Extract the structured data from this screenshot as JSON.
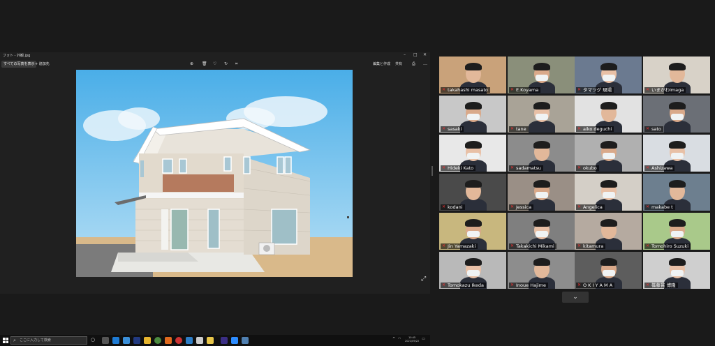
{
  "viewer": {
    "title": "フォト - 外観.jpg",
    "tab_label": "すべての写真を表示",
    "add_label": "追加先",
    "edit_label": "編集と作成",
    "share_label": "共有"
  },
  "taskbar": {
    "search_placeholder": "ここに入力して検索",
    "time": "10:45",
    "date": "2021/09/22"
  },
  "gallery": {
    "active_index": 0,
    "participants": [
      {
        "name": "takahashi masato"
      },
      {
        "name": "E.Koyama"
      },
      {
        "name": "タマツグ 現場"
      },
      {
        "name": "いまがわimaga"
      },
      {
        "name": "sasaki"
      },
      {
        "name": "tane"
      },
      {
        "name": "aiko deguchi"
      },
      {
        "name": "sato"
      },
      {
        "name": "Hideki Kato"
      },
      {
        "name": "sadamatsu"
      },
      {
        "name": "okubo"
      },
      {
        "name": "Ashizawa"
      },
      {
        "name": "kodani"
      },
      {
        "name": "Jessica"
      },
      {
        "name": "Angelica"
      },
      {
        "name": "makabe t"
      },
      {
        "name": "Jin Yamazaki"
      },
      {
        "name": "Takakichi Mikami"
      },
      {
        "name": "kitamura"
      },
      {
        "name": "Tomohiro Suzuki"
      },
      {
        "name": "Tomokazu Ikeda"
      },
      {
        "name": "Inoue Hajime"
      },
      {
        "name": "O K I Y A M A"
      },
      {
        "name": "篠藤貫 博隆"
      }
    ]
  },
  "more_label": "⌄"
}
